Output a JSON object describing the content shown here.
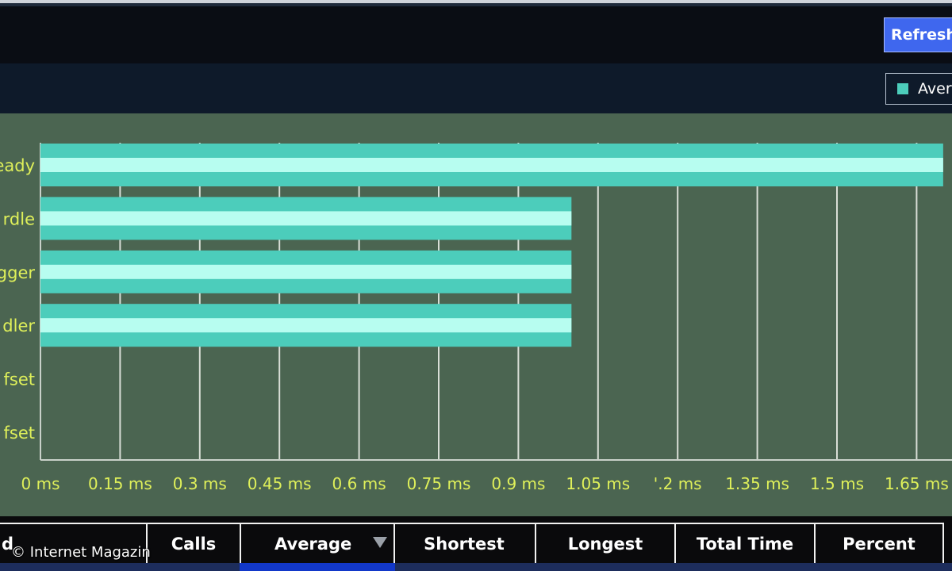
{
  "toolbar": {
    "refresh_label": "Refresh"
  },
  "legend": {
    "label": "Average",
    "color": "#4ccdbb"
  },
  "colors": {
    "bar_outer": "#4ccdbb",
    "bar_inner": "#b7fdf0",
    "plot_bg": "#4b6551",
    "tick_label": "#dff05a"
  },
  "chart_data": {
    "type": "bar",
    "orientation": "horizontal",
    "categories": [
      "eady",
      "rdle",
      "gger",
      "dler",
      "fset",
      "fset"
    ],
    "series": [
      {
        "name": "Average",
        "values": [
          1.7,
          1.0,
          1.0,
          1.0,
          0,
          0
        ]
      }
    ],
    "xlim": [
      0,
      1.75
    ],
    "xticks": [
      "0 ms",
      "0.15 ms",
      "0.3 ms",
      "0.45 ms",
      "0.6 ms",
      "0.75 ms",
      "0.9 ms",
      "1.05 ms",
      "'.2 ms",
      "1.35 ms",
      "1.5 ms",
      "1.65 ms"
    ],
    "grid": true,
    "legend": "top-right"
  },
  "table": {
    "headers": [
      "d",
      "Calls",
      "Average",
      "Shortest",
      "Longest",
      "Total Time",
      "Percent"
    ],
    "sort_icon": "sort-descending-icon"
  },
  "watermark": "© Internet Magazin"
}
